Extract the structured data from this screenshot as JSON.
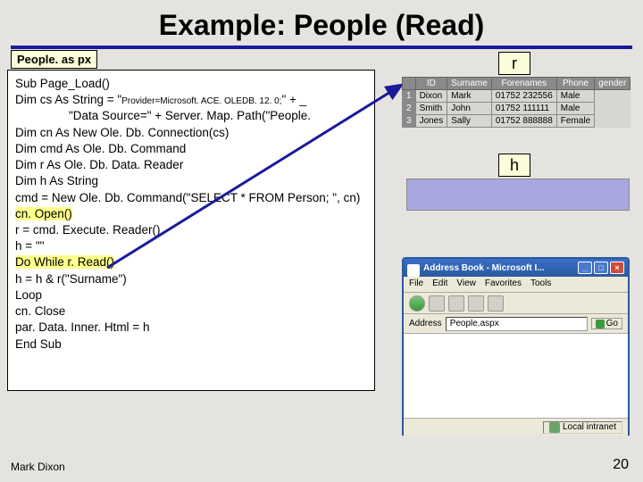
{
  "title": "Example: People (Read)",
  "filename": "People. as px",
  "r_label": "r",
  "h_label": "h",
  "code": {
    "l1": "Sub Page_Load()",
    "l2a": "Dim cs As String = \"",
    "l2b": "Provider=Microsoft. ACE. OLEDB. 12. 0;",
    "l2c": "\" + _",
    "l3": "\"Data Source=\" + Server. Map. Path(\"People.",
    "l4": "Dim cn   As New Ole. Db. Connection(cs)",
    "l5": "Dim cmd  As Ole. Db. Command",
    "l6": "Dim r   As Ole. Db. Data. Reader",
    "l7": "Dim h   As String",
    "l8": "   cmd = New Ole. Db. Command(\"SELECT * FROM Person; \", cn)",
    "l9": "   cn. Open()",
    "l10": "   r = cmd. Execute. Reader()",
    "l11": "   h = \"\"",
    "l12": "   Do While r. Read()",
    "l13": "      h = h & r(\"Surname\")",
    "l14": "   Loop",
    "l15": "   cn. Close",
    "l16": "   par. Data. Inner. Html = h",
    "l17": "End Sub"
  },
  "table": {
    "headers": [
      "ID",
      "Surname",
      "Forenames",
      "Phone",
      "gender"
    ],
    "rows": [
      [
        "1",
        "Dixon",
        "Mark",
        "01752 232556",
        "Male"
      ],
      [
        "2",
        "Smith",
        "John",
        "01752 111111",
        "Male"
      ],
      [
        "3",
        "Jones",
        "Sally",
        "01752 888888",
        "Female"
      ]
    ]
  },
  "browser": {
    "title": "Address Book - Microsoft I...",
    "menus": [
      "File",
      "Edit",
      "View",
      "Favorites",
      "Tools"
    ],
    "address_label": "Address",
    "address_value": "People.aspx",
    "go_label": "Go",
    "status": "Local intranet"
  },
  "footer": {
    "author": "Mark Dixon",
    "page": "20"
  }
}
